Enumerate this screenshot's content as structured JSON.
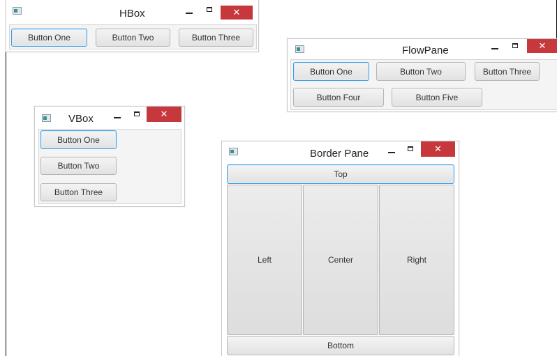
{
  "windows": {
    "hbox": {
      "title": "HBox",
      "close_glyph": "✕",
      "buttons": [
        "Button One",
        "Button Two",
        "Button Three"
      ]
    },
    "flowpane": {
      "title": "FlowPane",
      "close_glyph": "✕",
      "buttons": [
        "Button One",
        "Button Two",
        "Button Three",
        "Button Four",
        "Button Five"
      ]
    },
    "vbox": {
      "title": "VBox",
      "close_glyph": "✕",
      "buttons": [
        "Button One",
        "Button Two",
        "Button Three"
      ]
    },
    "borderpane": {
      "title": "Border Pane",
      "close_glyph": "✕",
      "regions": {
        "top": "Top",
        "left": "Left",
        "center": "Center",
        "right": "Right",
        "bottom": "Bottom"
      }
    }
  },
  "colors": {
    "close_button": "#c7383c",
    "focus_border": "#3d9be0"
  },
  "icons": {
    "window_icon": "java-window-icon",
    "minimize": "minimize-icon",
    "maximize": "maximize-icon",
    "close": "close-icon"
  }
}
